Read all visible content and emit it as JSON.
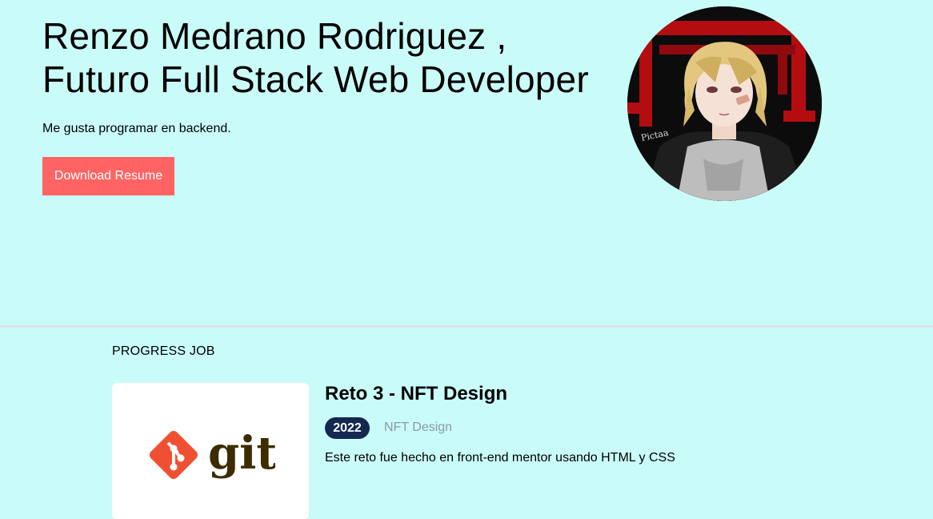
{
  "hero": {
    "title_line1": "Renzo Medrano Rodriguez ,",
    "title_line2": "Futuro Full Stack Web Developer",
    "subtitle": "Me gusta programar en backend.",
    "download_button": "Download Resume",
    "avatar_signature": "Pictaa"
  },
  "section": {
    "label": "PROGRESS JOB"
  },
  "job": {
    "logo_text": "git",
    "title": "Reto 3 - NFT Design",
    "year": "2022",
    "category": "NFT Design",
    "description": "Este reto fue hecho en front-end mentor usando HTML y CSS"
  },
  "colors": {
    "background": "#c9fcf8",
    "button": "#ff6464",
    "badge": "#142850",
    "muted_text": "#8a9aa6",
    "git_orange": "#f05032",
    "git_text": "#3e2c00"
  }
}
